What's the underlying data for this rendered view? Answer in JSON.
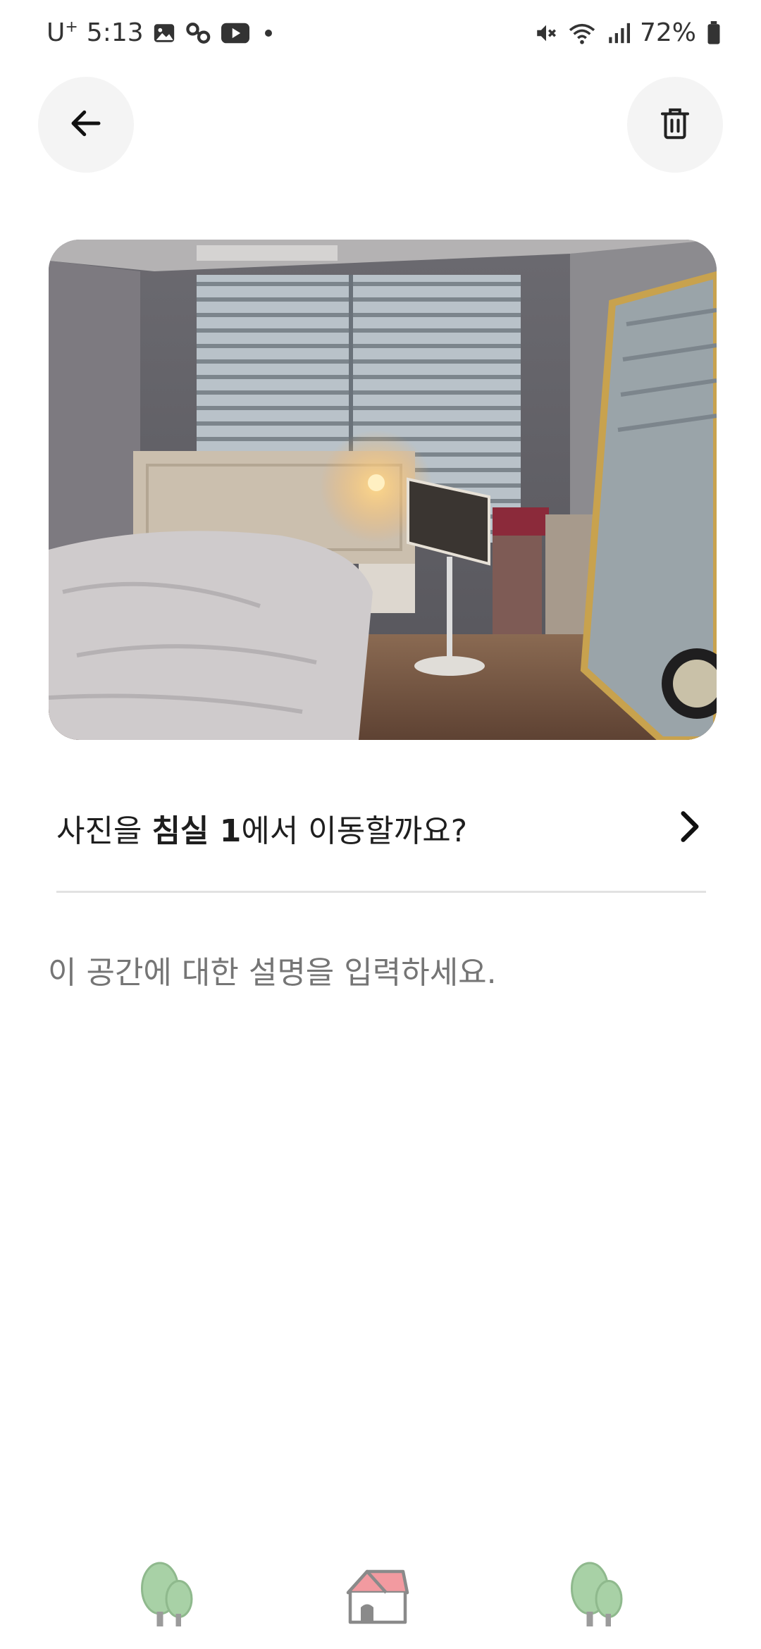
{
  "status_bar": {
    "carrier": "U",
    "carrier_sup": "+",
    "time": "5:13",
    "battery": "72%",
    "icons": [
      "gallery-icon",
      "link-icon",
      "youtube-icon",
      "dot-icon",
      "mute-icon",
      "wifi-icon",
      "signal-icon",
      "battery-icon"
    ]
  },
  "header": {
    "back_icon": "arrow-left-icon",
    "delete_icon": "trash-icon"
  },
  "photo": {
    "subject": "bedroom-photo"
  },
  "move_prompt": {
    "prefix": "사진을 ",
    "room": "침실 1",
    "suffix": "에서 이동할까요?",
    "chevron_icon": "chevron-right-icon"
  },
  "description": {
    "placeholder": "이 공간에 대한 설명을 입력하세요.",
    "value": ""
  },
  "bottom_nav": {
    "items": [
      "tree-icon",
      "house-icon",
      "tree-icon"
    ]
  },
  "colors": {
    "button_bg": "#f4f4f4",
    "divider": "#e2e2e2",
    "placeholder": "#8a8a8a",
    "house_roof": "#f29aa0",
    "tree_green": "#a8d1a6"
  }
}
